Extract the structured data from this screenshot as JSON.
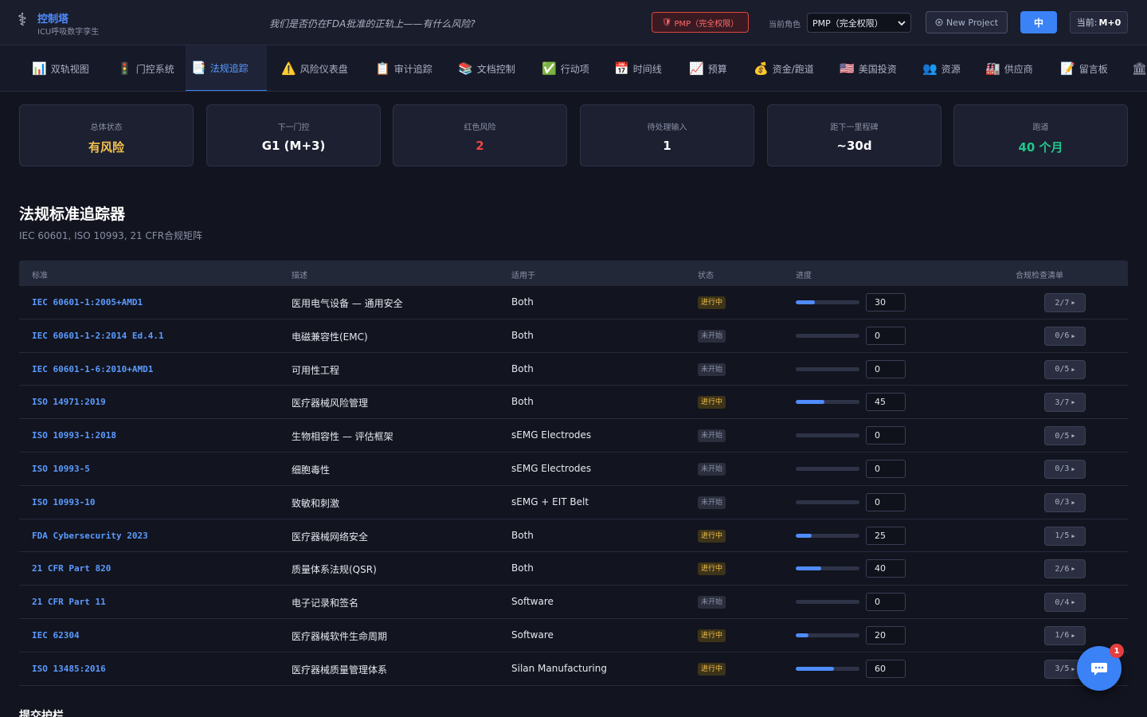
{
  "header": {
    "logo_icon": "⚕",
    "title": "控制塔",
    "subtitle": "ICU呼吸数字孪生",
    "tagline": "我们是否仍在FDA批准的正轨上——有什么风险?",
    "role_badge": "PMP（完全权限）",
    "role_label": "当前角色",
    "role_select": "PMP（完全权限）",
    "new_project": "New Project",
    "lang": "中",
    "month_prefix": "当前:",
    "month_value": "M+0"
  },
  "tabs": [
    {
      "icon": "📊",
      "label": "双轨视图"
    },
    {
      "icon": "🚦",
      "label": "门控系统"
    },
    {
      "icon": "📑",
      "label": "法规追踪"
    },
    {
      "icon": "⚠️",
      "label": "风险仪表盘"
    },
    {
      "icon": "📋",
      "label": "审计追踪"
    },
    {
      "icon": "📚",
      "label": "文档控制"
    },
    {
      "icon": "✅",
      "label": "行动项"
    },
    {
      "icon": "📅",
      "label": "时间线"
    },
    {
      "icon": "📈",
      "label": "预算"
    },
    {
      "icon": "💰",
      "label": "资金/跑道"
    },
    {
      "icon": "🇺🇸",
      "label": "美国投资"
    },
    {
      "icon": "👥",
      "label": "资源"
    },
    {
      "icon": "🏭",
      "label": "供应商"
    },
    {
      "icon": "📝",
      "label": "留言板"
    },
    {
      "icon": "🏛",
      "label": ""
    }
  ],
  "stats": [
    {
      "label": "总体状态",
      "value": "有风险",
      "color": "#f2c14e"
    },
    {
      "label": "下一门控",
      "value": "G1 (M+3)",
      "color": "#ffffff"
    },
    {
      "label": "红色风险",
      "value": "2",
      "color": "#ef4444"
    },
    {
      "label": "待处理输入",
      "value": "1",
      "color": "#ffffff"
    },
    {
      "label": "距下一里程碑",
      "value": "~30d",
      "color": "#ffffff"
    },
    {
      "label": "跑道",
      "value": "40 个月",
      "color": "#22c58b"
    }
  ],
  "section": {
    "title": "法规标准追踪器",
    "subtitle": "IEC 60601, ISO 10993, 21 CFR合规矩阵"
  },
  "table": {
    "headers": [
      "标准",
      "描述",
      "适用于",
      "状态",
      "进度",
      "合规检查清单"
    ],
    "rows": [
      {
        "standard": "IEC 60601-1:2005+AMD1",
        "desc": "医用电气设备 — 通用安全",
        "applies": "Both",
        "status": "进行中",
        "progress": 30,
        "checklist": "2/7"
      },
      {
        "standard": "IEC 60601-1-2:2014 Ed.4.1",
        "desc": "电磁兼容性(EMC)",
        "applies": "Both",
        "status": "未开始",
        "progress": 0,
        "checklist": "0/6"
      },
      {
        "standard": "IEC 60601-1-6:2010+AMD1",
        "desc": "可用性工程",
        "applies": "Both",
        "status": "未开始",
        "progress": 0,
        "checklist": "0/5"
      },
      {
        "standard": "ISO 14971:2019",
        "desc": "医疗器械风险管理",
        "applies": "Both",
        "status": "进行中",
        "progress": 45,
        "checklist": "3/7"
      },
      {
        "standard": "ISO 10993-1:2018",
        "desc": "生物相容性 — 评估框架",
        "applies": "sEMG Electrodes",
        "status": "未开始",
        "progress": 0,
        "checklist": "0/5"
      },
      {
        "standard": "ISO 10993-5",
        "desc": "细胞毒性",
        "applies": "sEMG Electrodes",
        "status": "未开始",
        "progress": 0,
        "checklist": "0/3"
      },
      {
        "standard": "ISO 10993-10",
        "desc": "致敏和刺激",
        "applies": "sEMG + EIT Belt",
        "status": "未开始",
        "progress": 0,
        "checklist": "0/3"
      },
      {
        "standard": "FDA Cybersecurity 2023",
        "desc": "医疗器械网络安全",
        "applies": "Both",
        "status": "进行中",
        "progress": 25,
        "checklist": "1/5"
      },
      {
        "standard": "21 CFR Part 820",
        "desc": "质量体系法规(QSR)",
        "applies": "Both",
        "status": "进行中",
        "progress": 40,
        "checklist": "2/6"
      },
      {
        "standard": "21 CFR Part 11",
        "desc": "电子记录和签名",
        "applies": "Software",
        "status": "未开始",
        "progress": 0,
        "checklist": "0/4"
      },
      {
        "standard": "IEC 62304",
        "desc": "医疗器械软件生命周期",
        "applies": "Software",
        "status": "进行中",
        "progress": 20,
        "checklist": "1/6"
      },
      {
        "standard": "ISO 13485:2016",
        "desc": "医疗器械质量管理体系",
        "applies": "Silan Manufacturing",
        "status": "进行中",
        "progress": 60,
        "checklist": "3/5"
      }
    ]
  },
  "bottom_section_title": "提交护栏",
  "chat_badge": "1"
}
